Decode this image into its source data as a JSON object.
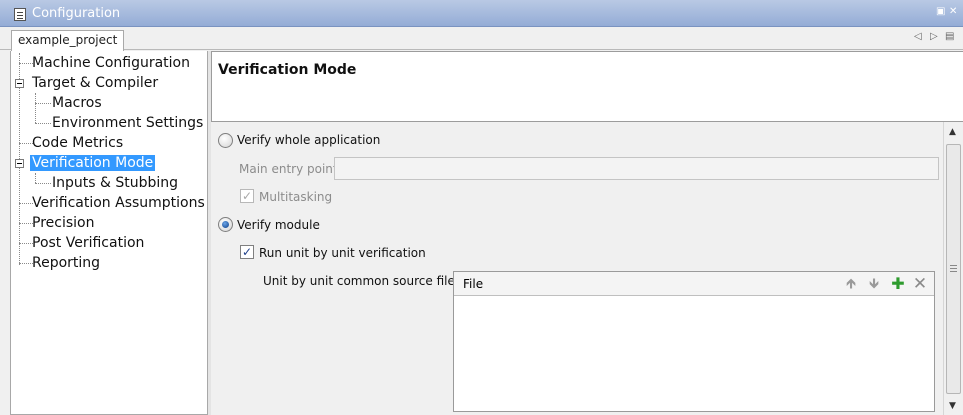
{
  "window": {
    "title": "Configuration"
  },
  "tabs": {
    "active_label": "example_project"
  },
  "tree": {
    "items": [
      {
        "label": "Machine Configuration"
      },
      {
        "label": "Target & Compiler"
      },
      {
        "label": "Macros"
      },
      {
        "label": "Environment Settings"
      },
      {
        "label": "Code Metrics"
      },
      {
        "label": "Verification Mode"
      },
      {
        "label": "Inputs & Stubbing"
      },
      {
        "label": "Verification Assumptions"
      },
      {
        "label": "Precision"
      },
      {
        "label": "Post Verification"
      },
      {
        "label": "Reporting"
      }
    ],
    "selected": "Verification Mode"
  },
  "panel": {
    "title": "Verification Mode",
    "verify_whole_app_label": "Verify whole application",
    "main_entry_point_label": "Main entry point",
    "main_entry_point_value": "",
    "multitasking_label": "Multitasking",
    "multitasking_checked": true,
    "verify_module_label": "Verify module",
    "verify_module_selected": true,
    "run_unit_label": "Run unit by unit verification",
    "run_unit_checked": true,
    "common_files_label": "Unit by unit common source files",
    "table": {
      "column_file": "File",
      "rows": []
    }
  },
  "icons": {
    "doc": "document-icon",
    "move_up": "arrow-up-icon",
    "move_down": "arrow-down-icon",
    "add": "plus-icon",
    "remove": "close-icon"
  },
  "colors": {
    "selection": "#3399ff",
    "titlebar": "#a9bde0",
    "add_icon": "#2e9b2e"
  }
}
